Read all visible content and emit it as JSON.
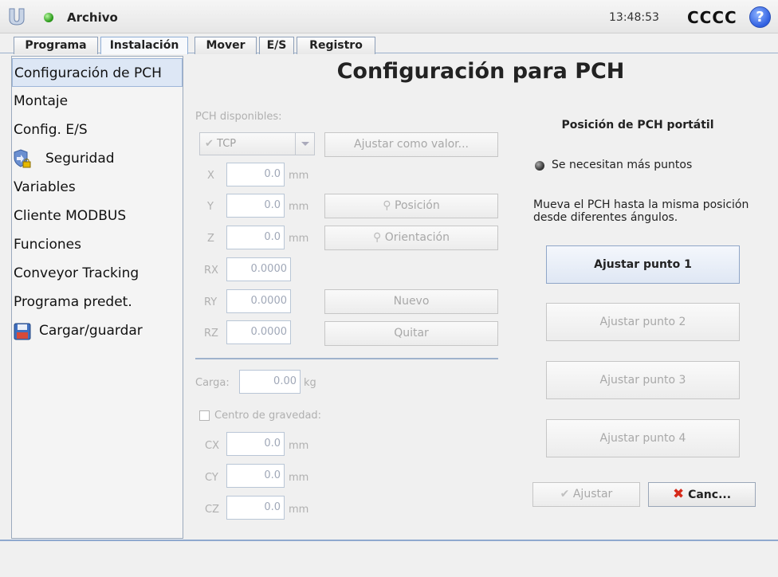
{
  "topbar": {
    "file_menu": "Archivo",
    "clock": "13:48:53",
    "robot_name": "CCCC",
    "help_label": "?"
  },
  "tabs": [
    {
      "label": "Programa"
    },
    {
      "label": "Instalación",
      "active": true
    },
    {
      "label": "Mover"
    },
    {
      "label": "E/S"
    },
    {
      "label": "Registro"
    }
  ],
  "sidebar": {
    "items": [
      {
        "label": "Configuración de PCH",
        "selected": true
      },
      {
        "label": "Montaje"
      },
      {
        "label": "Config. E/S"
      },
      {
        "label": "Seguridad",
        "icon": "shield-lock-icon"
      },
      {
        "label": "Variables"
      },
      {
        "label": "Cliente MODBUS"
      },
      {
        "label": "Funciones"
      },
      {
        "label": "Conveyor Tracking"
      },
      {
        "label": "Programa predet."
      },
      {
        "label": "Cargar/guardar",
        "icon": "floppy-disk-icon"
      }
    ]
  },
  "main": {
    "title": "Configuración para PCH",
    "available_label": "PCH disponibles:",
    "tcp_select": "TCP",
    "set_default_button": "Ajustar como valor...",
    "position_button": "Posición",
    "orientation_button": "Orientación",
    "new_button": "Nuevo",
    "remove_button": "Quitar",
    "coords": {
      "x": {
        "label": "X",
        "value": "0.0",
        "unit": "mm"
      },
      "y": {
        "label": "Y",
        "value": "0.0",
        "unit": "mm"
      },
      "z": {
        "label": "Z",
        "value": "0.0",
        "unit": "mm"
      },
      "rx": {
        "label": "RX",
        "value": "0.0000"
      },
      "ry": {
        "label": "RY",
        "value": "0.0000"
      },
      "rz": {
        "label": "RZ",
        "value": "0.0000"
      }
    },
    "payload": {
      "label": "Carga:",
      "value": "0.00",
      "unit": "kg"
    },
    "cog_label": "Centro de gravedad:",
    "cog": {
      "cx": {
        "label": "CX",
        "value": "0.0",
        "unit": "mm"
      },
      "cy": {
        "label": "CY",
        "value": "0.0",
        "unit": "mm"
      },
      "cz": {
        "label": "CZ",
        "value": "0.0",
        "unit": "mm"
      }
    }
  },
  "wizard": {
    "title": "Posición de PCH portátil",
    "status": "Se necesitan más puntos",
    "instruction": "Mueva el PCH hasta la misma posición desde diferentes ángulos.",
    "point_buttons": [
      "Ajustar punto 1",
      "Ajustar punto 2",
      "Ajustar punto 3",
      "Ajustar punto 4"
    ],
    "apply_button": "Ajustar",
    "cancel_button": "Canc..."
  },
  "colors": {
    "accent": "#9fb2cc",
    "status_ok": "#2a9a1a",
    "help_blue": "#2f5fe0",
    "cancel_x": "#d62a1a"
  }
}
